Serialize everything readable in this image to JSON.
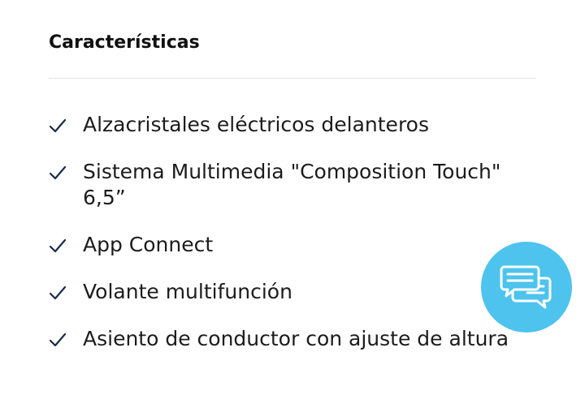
{
  "section": {
    "title": "Características"
  },
  "features": [
    {
      "label": "Alzacristales eléctricos delanteros"
    },
    {
      "label": "Sistema Multimedia \"Composition Touch\" 6,5”"
    },
    {
      "label": "App Connect"
    },
    {
      "label": "Volante multifunción"
    },
    {
      "label": "Asiento de conductor con ajuste de altura"
    }
  ],
  "icons": {
    "check": "check-icon",
    "chat": "chat-bubbles-icon"
  },
  "colors": {
    "check": "#1a2b4a",
    "chat_button": "#4dc3ee"
  }
}
